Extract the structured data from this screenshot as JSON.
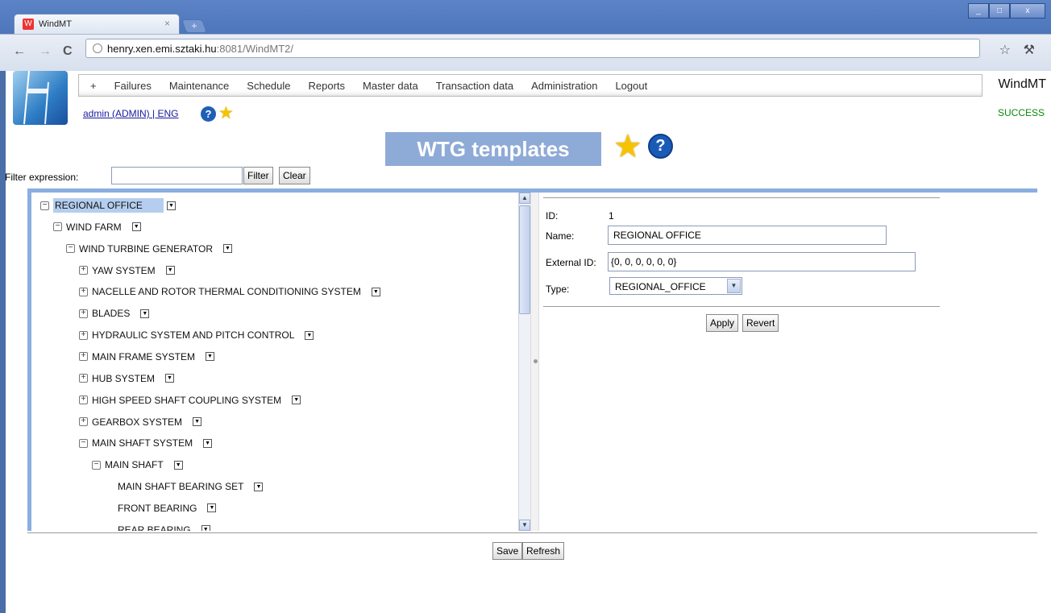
{
  "browser": {
    "tab_title": "WindMT",
    "tab_close": "×",
    "new_tab": "+",
    "url_host": "henry.xen.emi.sztaki.hu",
    "url_rest": ":8081/WindMT2/",
    "window_controls": {
      "minimize": "_",
      "maximize": "□",
      "close": "x"
    }
  },
  "header": {
    "menu": [
      "+",
      "Failures",
      "Maintenance",
      "Schedule",
      "Reports",
      "Master data",
      "Transaction data",
      "Administration",
      "Logout"
    ],
    "brand": "WindMT",
    "status": "SUCCESS",
    "user_link": "admin (ADMIN) | ENG"
  },
  "page_title": "WTG templates",
  "filter": {
    "label": "Filter expression:",
    "value": "",
    "filter_button": "Filter",
    "clear_button": "Clear"
  },
  "tree": [
    {
      "label": "REGIONAL OFFICE",
      "toggle": "⊟",
      "level": 0,
      "selected": true
    },
    {
      "label": "WIND FARM",
      "toggle": "⊟",
      "level": 1
    },
    {
      "label": "WIND TURBINE GENERATOR",
      "toggle": "⊟",
      "level": 2
    },
    {
      "label": "YAW SYSTEM",
      "toggle": "⊞",
      "level": 3
    },
    {
      "label": "NACELLE AND ROTOR THERMAL CONDITIONING SYSTEM",
      "toggle": "⊞",
      "level": 3
    },
    {
      "label": "BLADES",
      "toggle": "⊞",
      "level": 3
    },
    {
      "label": "HYDRAULIC SYSTEM AND PITCH CONTROL",
      "toggle": "⊞",
      "level": 3
    },
    {
      "label": "MAIN FRAME SYSTEM",
      "toggle": "⊞",
      "level": 3
    },
    {
      "label": "HUB SYSTEM",
      "toggle": "⊞",
      "level": 3
    },
    {
      "label": "HIGH SPEED SHAFT COUPLING SYSTEM",
      "toggle": "⊞",
      "level": 3
    },
    {
      "label": "GEARBOX SYSTEM",
      "toggle": "⊞",
      "level": 3
    },
    {
      "label": "MAIN SHAFT SYSTEM",
      "toggle": "⊟",
      "level": 3
    },
    {
      "label": "MAIN SHAFT",
      "toggle": "⊟",
      "level": 4
    },
    {
      "label": "MAIN SHAFT BEARING SET",
      "toggle": "",
      "level": 5
    },
    {
      "label": "FRONT BEARING",
      "toggle": "",
      "level": 5
    },
    {
      "label": "REAR BEARING",
      "toggle": "",
      "level": 5
    }
  ],
  "details": {
    "id_label": "ID:",
    "id_value": "1",
    "name_label": "Name:",
    "name_value": "REGIONAL OFFICE",
    "external_id_label": "External ID:",
    "external_id_value": "{0, 0, 0, 0, 0, 0}",
    "type_label": "Type:",
    "type_value": "REGIONAL_OFFICE",
    "apply_button": "Apply",
    "revert_button": "Revert"
  },
  "footer": {
    "save_button": "Save",
    "refresh_button": "Refresh"
  }
}
